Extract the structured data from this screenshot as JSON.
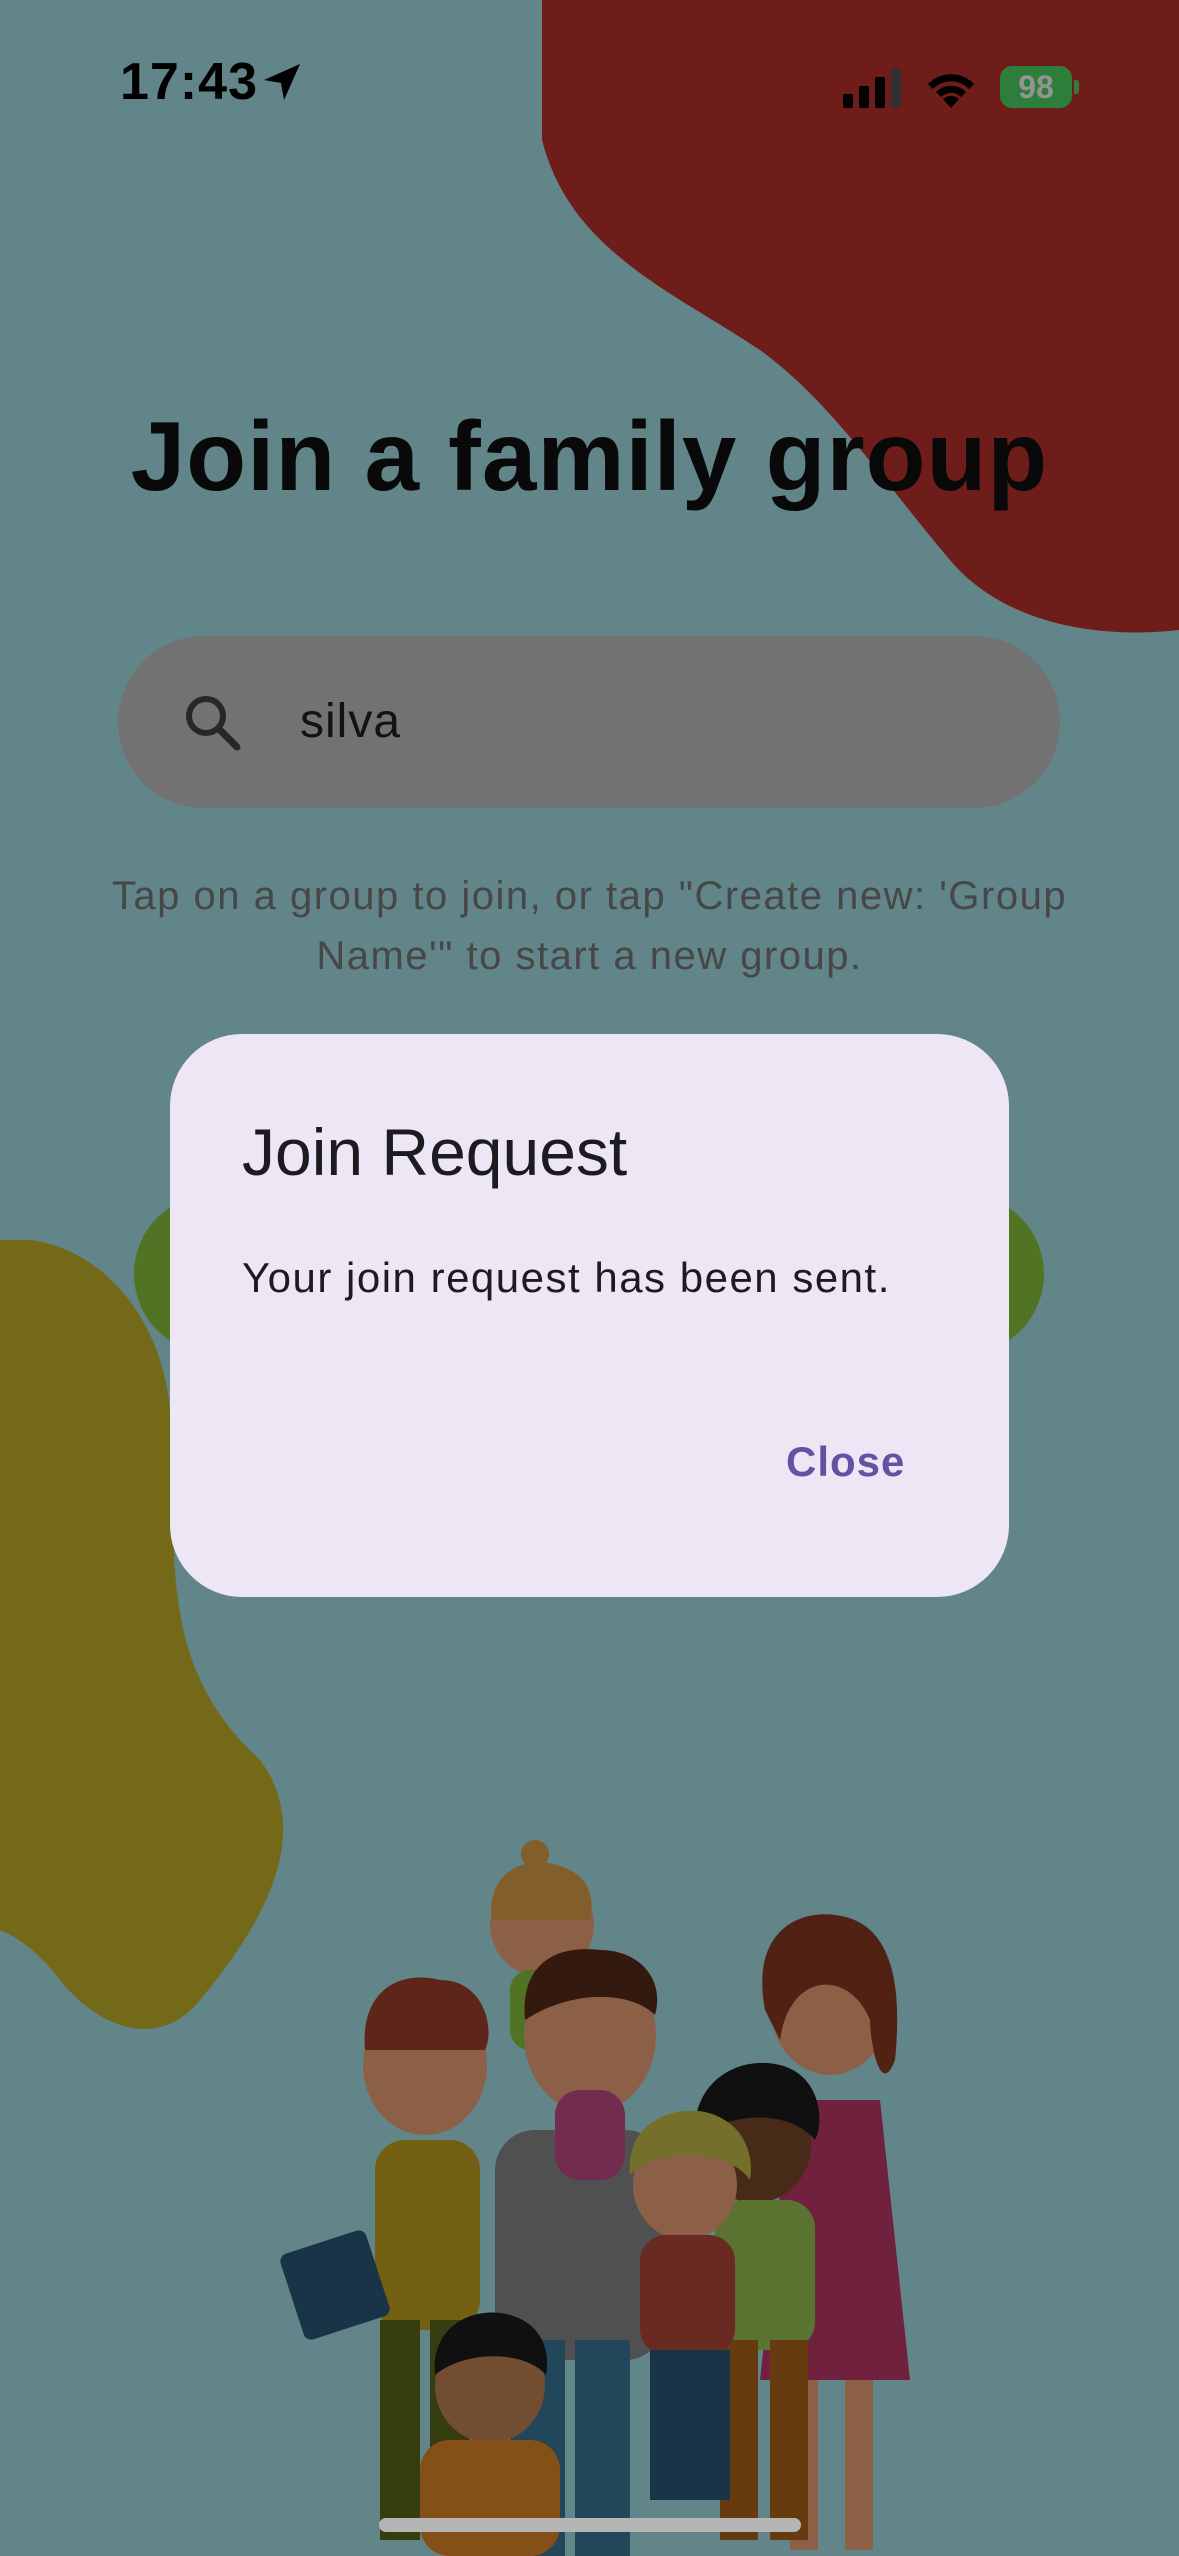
{
  "status_bar": {
    "time": "17:43",
    "battery": "98",
    "icons": [
      "location-arrow-icon",
      "cellular-signal-icon",
      "wifi-icon",
      "battery-charging-icon"
    ]
  },
  "page": {
    "title": "Join a family group",
    "search": {
      "value": "silva",
      "icon": "search-icon"
    },
    "hint": "Tap on a group to join, or tap \"Create new: 'Group Name'\" to start a new group."
  },
  "dialog": {
    "title": "Join Request",
    "message": "Your join request has been sent.",
    "close_label": "Close"
  },
  "colors": {
    "background": "#a8e5ea",
    "blob_red": "#c0322f",
    "blob_yellow": "#c9b52b",
    "accent_purple": "#6750a4",
    "dialog_surface": "#ede7f5",
    "button_green": "#8cc63f",
    "battery_green": "#4cd964"
  }
}
